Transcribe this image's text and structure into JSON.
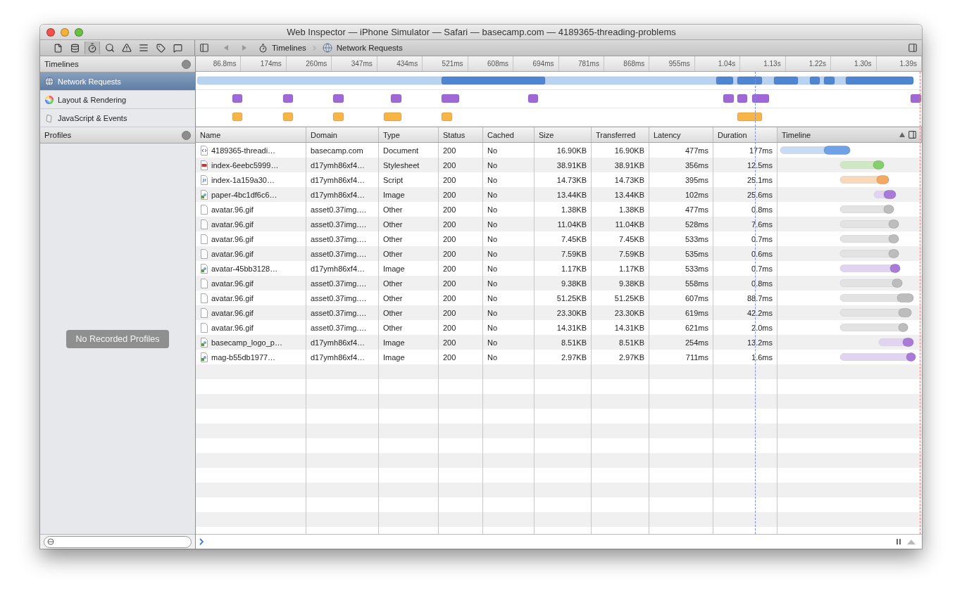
{
  "window": {
    "title": "Web Inspector — iPhone Simulator — Safari — basecamp.com — 4189365-threading-problems"
  },
  "breadcrumbs": [
    {
      "label": "Timelines",
      "kind": "timelines"
    },
    {
      "label": "Network Requests",
      "kind": "network"
    }
  ],
  "sidebar": {
    "timelines_header": "Timelines",
    "timelines": [
      {
        "label": "Network Requests",
        "kind": "network",
        "selected": true
      },
      {
        "label": "Layout & Rendering",
        "kind": "layout",
        "selected": false
      },
      {
        "label": "JavaScript & Events",
        "kind": "script",
        "selected": false
      }
    ],
    "profiles_header": "Profiles",
    "profiles_empty": "No Recorded Profiles"
  },
  "ruler": [
    "86.8ms",
    "174ms",
    "260ms",
    "347ms",
    "434ms",
    "521ms",
    "608ms",
    "694ms",
    "781ms",
    "868ms",
    "955ms",
    "1.04s",
    "1.13s",
    "1.22s",
    "1.30s",
    "1.39s"
  ],
  "table": {
    "columns": [
      {
        "label": "Name",
        "sorted": false
      },
      {
        "label": "Domain",
        "sorted": false
      },
      {
        "label": "Type",
        "sorted": false
      },
      {
        "label": "Status",
        "sorted": false
      },
      {
        "label": "Cached",
        "sorted": false
      },
      {
        "label": "Size",
        "sorted": false
      },
      {
        "label": "Transferred",
        "sorted": false
      },
      {
        "label": "Latency",
        "sorted": false
      },
      {
        "label": "Duration",
        "sorted": false
      },
      {
        "label": "Timeline",
        "sorted": true
      }
    ],
    "rows": [
      {
        "kind": "document",
        "cells": [
          "4189365-threadi…",
          "basecamp.com",
          "Document",
          "200",
          "No",
          "16.90KB",
          "16.90KB",
          "477ms",
          "177ms"
        ]
      },
      {
        "kind": "stylesheet",
        "cells": [
          "index-6eebc5999…",
          "d17ymh86xf4…",
          "Stylesheet",
          "200",
          "No",
          "38.91KB",
          "38.91KB",
          "356ms",
          "12.5ms"
        ]
      },
      {
        "kind": "script",
        "cells": [
          "index-1a159a30…",
          "d17ymh86xf4…",
          "Script",
          "200",
          "No",
          "14.73KB",
          "14.73KB",
          "395ms",
          "25.1ms"
        ]
      },
      {
        "kind": "image",
        "cells": [
          "paper-4bc1df6c6…",
          "d17ymh86xf4…",
          "Image",
          "200",
          "No",
          "13.44KB",
          "13.44KB",
          "102ms",
          "25.6ms"
        ]
      },
      {
        "kind": "other",
        "cells": [
          "avatar.96.gif",
          "asset0.37img.…",
          "Other",
          "200",
          "No",
          "1.38KB",
          "1.38KB",
          "477ms",
          "0.8ms"
        ]
      },
      {
        "kind": "other",
        "cells": [
          "avatar.96.gif",
          "asset0.37img.…",
          "Other",
          "200",
          "No",
          "11.04KB",
          "11.04KB",
          "528ms",
          "7.6ms"
        ]
      },
      {
        "kind": "other",
        "cells": [
          "avatar.96.gif",
          "asset0.37img.…",
          "Other",
          "200",
          "No",
          "7.45KB",
          "7.45KB",
          "533ms",
          "0.7ms"
        ]
      },
      {
        "kind": "other",
        "cells": [
          "avatar.96.gif",
          "asset0.37img.…",
          "Other",
          "200",
          "No",
          "7.59KB",
          "7.59KB",
          "535ms",
          "0.6ms"
        ]
      },
      {
        "kind": "image",
        "cells": [
          "avatar-45bb3128…",
          "d17ymh86xf4…",
          "Image",
          "200",
          "No",
          "1.17KB",
          "1.17KB",
          "533ms",
          "0.7ms"
        ]
      },
      {
        "kind": "other",
        "cells": [
          "avatar.96.gif",
          "asset0.37img.…",
          "Other",
          "200",
          "No",
          "9.38KB",
          "9.38KB",
          "558ms",
          "0.8ms"
        ]
      },
      {
        "kind": "other",
        "cells": [
          "avatar.96.gif",
          "asset0.37img.…",
          "Other",
          "200",
          "No",
          "51.25KB",
          "51.25KB",
          "607ms",
          "88.7ms"
        ]
      },
      {
        "kind": "other",
        "cells": [
          "avatar.96.gif",
          "asset0.37img.…",
          "Other",
          "200",
          "No",
          "23.30KB",
          "23.30KB",
          "619ms",
          "42.2ms"
        ]
      },
      {
        "kind": "other",
        "cells": [
          "avatar.96.gif",
          "asset0.37img.…",
          "Other",
          "200",
          "No",
          "14.31KB",
          "14.31KB",
          "621ms",
          "2.0ms"
        ]
      },
      {
        "kind": "image",
        "cells": [
          "basecamp_logo_p…",
          "d17ymh86xf4…",
          "Image",
          "200",
          "No",
          "8.51KB",
          "8.51KB",
          "254ms",
          "13.2ms"
        ]
      },
      {
        "kind": "image",
        "cells": [
          "mag-b55db1977…",
          "d17ymh86xf4…",
          "Image",
          "200",
          "No",
          "2.97KB",
          "2.97KB",
          "711ms",
          "1.6ms"
        ]
      }
    ]
  }
}
